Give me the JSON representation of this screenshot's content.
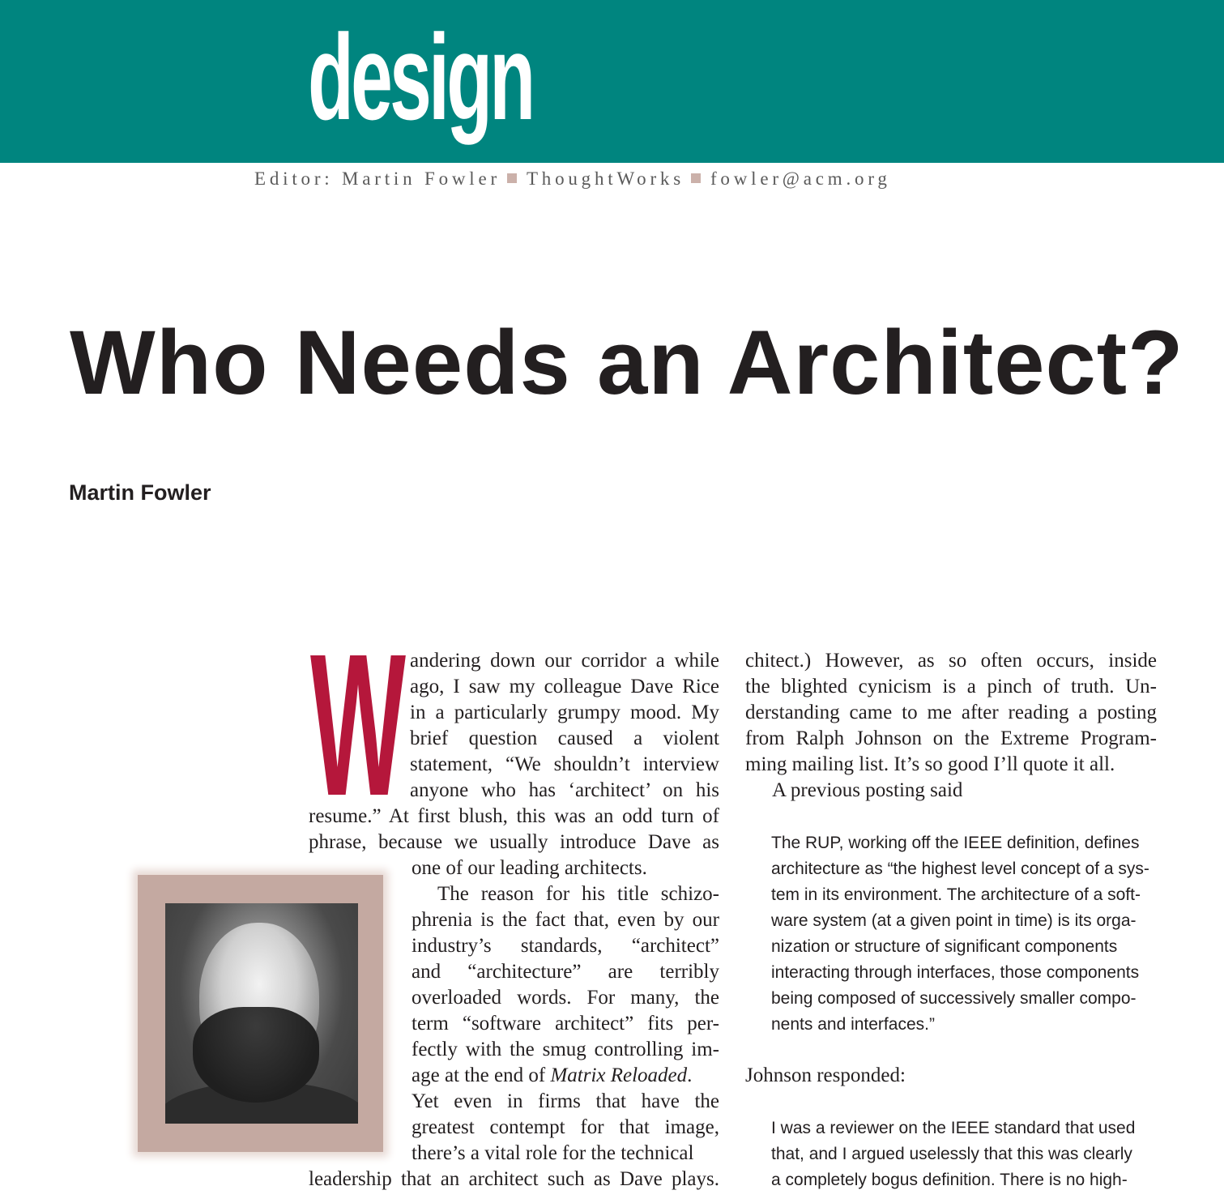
{
  "header": {
    "section": "design",
    "editor_label": "Editor: Martin Fowler",
    "company": "ThoughtWorks",
    "email": "fowler@acm.org"
  },
  "article": {
    "title": "Who Needs an Architect?",
    "author": "Martin Fowler",
    "drop_cap": "W"
  },
  "columns": {
    "left": [
      "andering down our corridor a while",
      "ago, I saw my colleague Dave Rice",
      "in a particularly grumpy mood. My",
      "brief question caused a violent",
      "statement, “We shouldn’t interview",
      "anyone who has ‘architect’ on his",
      "resume.” At first blush, this was an odd turn of",
      "phrase, because we usually introduce Dave as",
      "one of our leading architects.",
      "The reason for his title schizo-",
      "phrenia is the fact that, even by our",
      "industry’s standards, “architect”",
      "and “architecture” are terribly",
      "overloaded words. For many, the",
      "term “software architect” fits per-",
      "fectly with the smug controlling im-",
      "age at the end of ",
      "Matrix Reloaded",
      ".",
      "Yet even in firms that have the",
      "greatest contempt for that image,",
      "there’s a vital role for the technical",
      "leadership that an architect such as Dave plays."
    ],
    "right": [
      "chitect.) However, as so often occurs, inside",
      "the blighted cynicism is a pinch of truth. Un-",
      "derstanding came to me after reading a posting",
      "from Ralph Johnson on the Extreme Program-",
      "ming mailing list. It’s so good I’ll quote it all.",
      "A previous posting said"
    ],
    "quote1": [
      "The RUP, working off the IEEE definition, defines",
      "architecture as “the highest level concept of a sys-",
      "tem in its environment. The architecture of a soft-",
      "ware system (at a given point in time) is its orga-",
      "nization or structure of significant components",
      "interacting through interfaces, those components",
      "being composed of successively smaller compo-",
      "nents and interfaces.”"
    ],
    "response": "Johnson responded:",
    "quote2": [
      "I was a reviewer on the IEEE standard that used",
      "that, and I argued uselessly that this was clearly",
      "a completely bogus definition. There is no high-"
    ]
  },
  "colors": {
    "banner": "#00857f",
    "drop_cap": "#b5173b",
    "photo_frame": "#c4a9a1"
  }
}
